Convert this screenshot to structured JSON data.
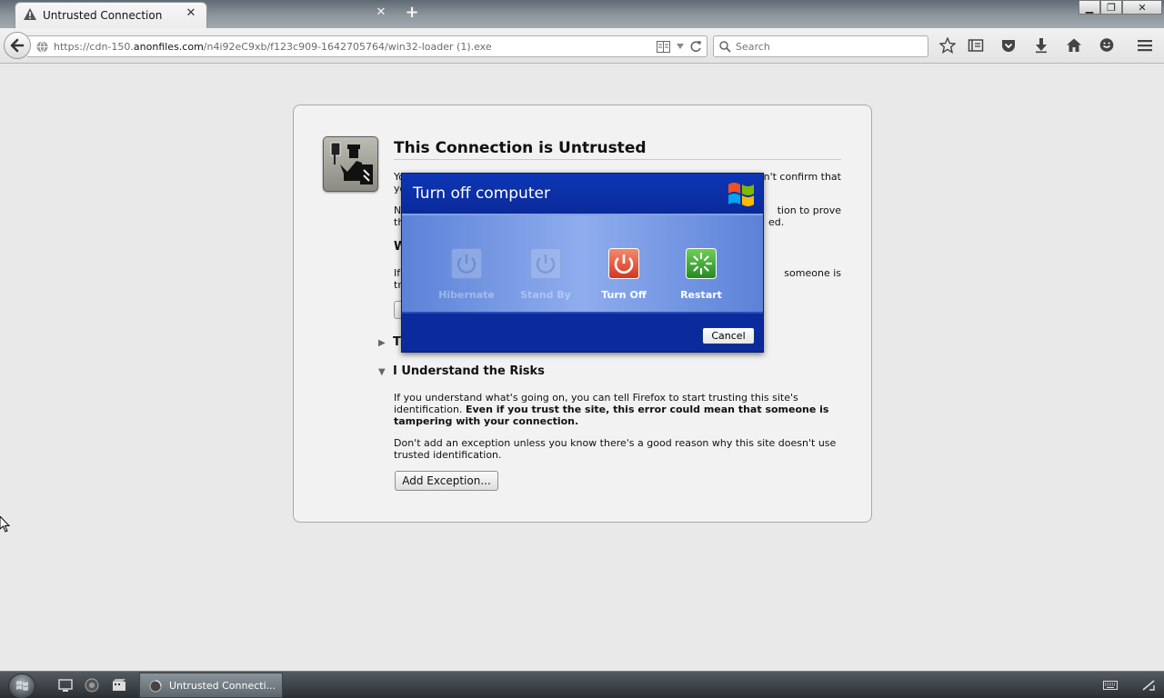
{
  "tabs": [
    {
      "title": "Untrusted Connection",
      "icon": "warning-icon",
      "active": true
    },
    {
      "title": "",
      "icon": "",
      "active": false
    }
  ],
  "navbar": {
    "url_prefix": "https://cdn-150.",
    "url_host": "anonfiles.com",
    "url_path": "/n4i92eC9xb/f123c909-1642705764/win32-loader (1).exe",
    "search_placeholder": "Search"
  },
  "error_page": {
    "title": "This Connection is Untrusted",
    "intro_visible_start": "Yo",
    "intro_visible_end": "n't confirm that",
    "line2_start": "yo",
    "para2_start": "N",
    "para2_end_1": "tion to prove",
    "para2_start_2": "th",
    "para2_end_2": "ed.",
    "section_what_start": "W",
    "para3_start": "If",
    "para3_end": "someone is",
    "para3_start_2": "tr",
    "section_technical_start": "T",
    "section_risks": "I Understand the Risks",
    "risks_p1_normal": "If you understand what's going on, you can tell Firefox to start trusting this site's identification. ",
    "risks_p1_bold": "Even if you trust the site, this error could mean that someone is tampering with your connection.",
    "risks_p2": "Don't add an exception unless you know there's a good reason why this site doesn't use trusted identification.",
    "add_exception": "Add Exception..."
  },
  "dialog": {
    "title": "Turn off computer",
    "options": [
      {
        "label": "Hibernate",
        "icon": "power-icon",
        "enabled": false
      },
      {
        "label": "Stand By",
        "icon": "power-icon",
        "enabled": false
      },
      {
        "label": "Turn Off",
        "icon": "power-icon",
        "enabled": true,
        "color": "#e0432f"
      },
      {
        "label": "Restart",
        "icon": "restart-icon",
        "enabled": true,
        "color": "#2f9a2f"
      }
    ],
    "cancel": "Cancel"
  },
  "taskbar": {
    "task_label": "Untrusted Connecti..."
  }
}
